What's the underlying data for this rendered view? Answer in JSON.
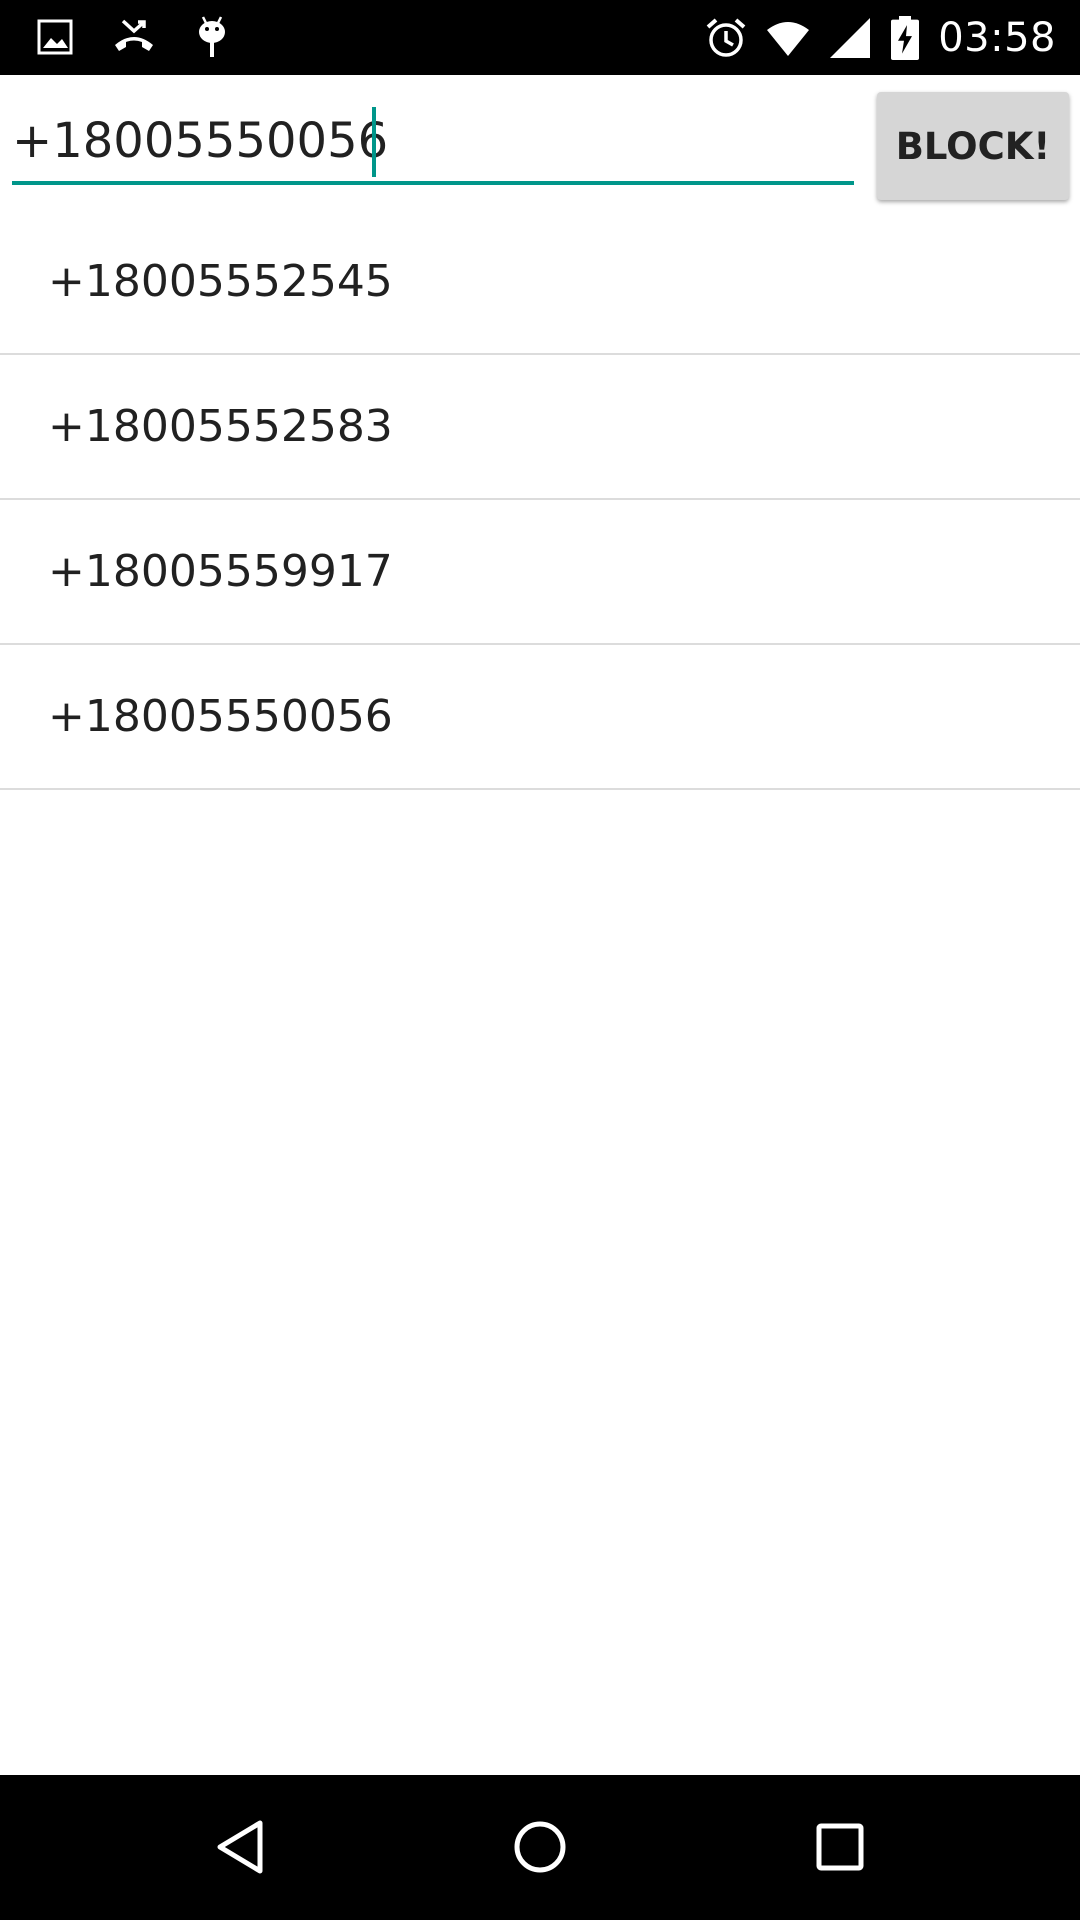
{
  "status_bar": {
    "time": "03:58",
    "left_icons": [
      "image-icon",
      "missed-call-icon",
      "android-debug-icon"
    ],
    "right_icons": [
      "alarm-icon",
      "wifi-icon",
      "signal-icon",
      "battery-charging-icon"
    ]
  },
  "input": {
    "value": "+18005550056"
  },
  "block_button": {
    "label": "BLOCK!"
  },
  "blocked_numbers": [
    "+18005552545",
    "+18005552583",
    "+18005559917",
    "+18005550056"
  ],
  "nav_bar": {
    "buttons": [
      "back-icon",
      "home-icon",
      "recents-icon"
    ]
  },
  "colors": {
    "accent": "#00968a",
    "status_bar": "#000000",
    "button_bg": "#d6d6d6",
    "divider": "#dcdcdc"
  }
}
